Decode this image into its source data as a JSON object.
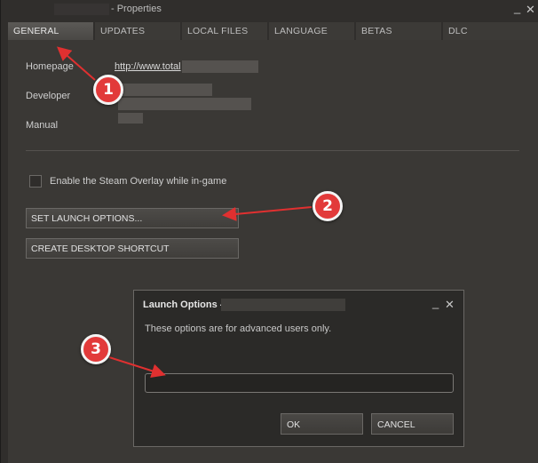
{
  "window": {
    "title": "- Properties",
    "minimize_glyph": "_",
    "close_glyph": "✕"
  },
  "tabs": [
    {
      "label": "GENERAL",
      "active": true
    },
    {
      "label": "UPDATES",
      "active": false
    },
    {
      "label": "LOCAL FILES",
      "active": false
    },
    {
      "label": "LANGUAGE",
      "active": false
    },
    {
      "label": "BETAS",
      "active": false
    },
    {
      "label": "DLC",
      "active": false
    }
  ],
  "general": {
    "homepage_label": "Homepage",
    "homepage_link": "http://www.total",
    "developer_label": "Developer",
    "manual_label": "Manual",
    "overlay_checkbox_label": "Enable the Steam Overlay while in-game",
    "overlay_checked": false,
    "set_launch_options_label": "SET LAUNCH OPTIONS...",
    "create_shortcut_label": "CREATE DESKTOP SHORTCUT"
  },
  "launch_dialog": {
    "title": "Launch Options -",
    "message": "These options are for advanced users only.",
    "input_value": "",
    "ok_label": "OK",
    "cancel_label": "CANCEL",
    "minimize_glyph": "_",
    "close_glyph": "✕"
  },
  "callouts": [
    "1",
    "2",
    "3"
  ],
  "colors": {
    "callout_fill": "#e23a3a",
    "arrow": "#e03030",
    "panel_bg": "#3a3835",
    "dialog_bg": "#2b2a28"
  }
}
